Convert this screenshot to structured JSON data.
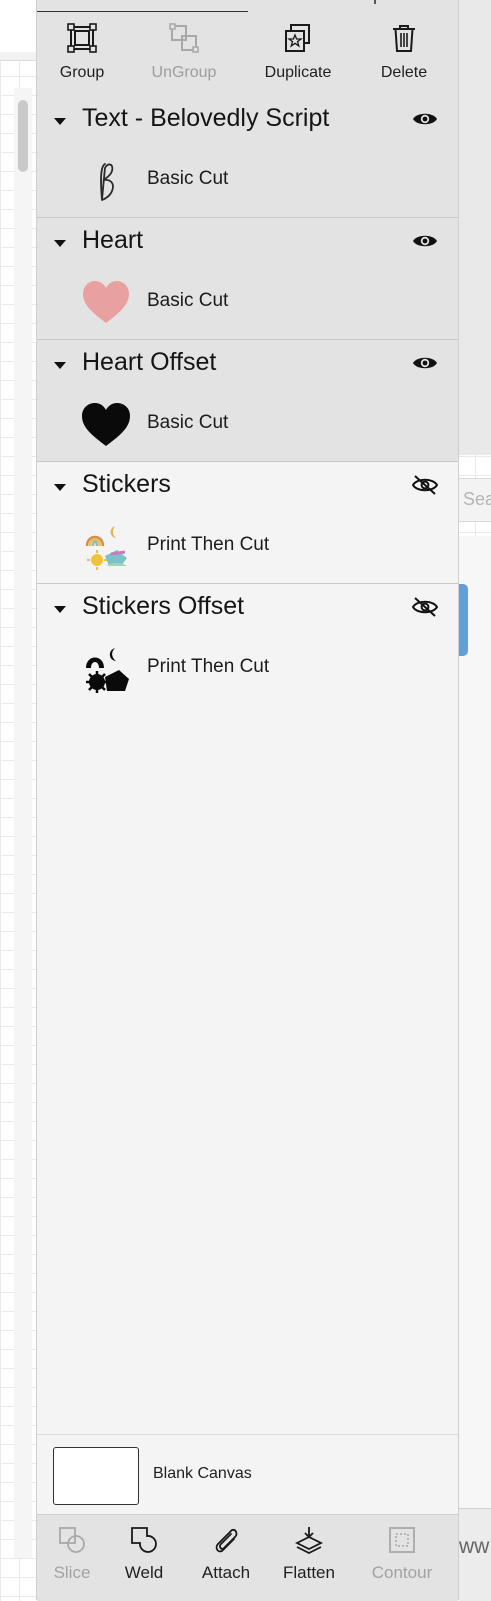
{
  "toolbar": {
    "group": "Group",
    "ungroup": "UnGroup",
    "duplicate": "Duplicate",
    "delete": "Delete"
  },
  "layers": [
    {
      "title": "Text - Belovedly Script",
      "operation": "Basic Cut",
      "visible": true,
      "thumbnail": "script-b-glyph",
      "selected": true
    },
    {
      "title": "Heart",
      "operation": "Basic Cut",
      "visible": true,
      "thumbnail": "pink-heart",
      "selected": true
    },
    {
      "title": "Heart Offset",
      "operation": "Basic Cut",
      "visible": true,
      "thumbnail": "black-heart",
      "selected": true
    },
    {
      "title": "Stickers",
      "operation": "Print Then Cut",
      "visible": false,
      "thumbnail": "color-stickers",
      "selected": false
    },
    {
      "title": "Stickers Offset",
      "operation": "Print Then Cut",
      "visible": false,
      "thumbnail": "black-sticker-silhouettes",
      "selected": false
    }
  ],
  "canvas": {
    "label": "Blank Canvas"
  },
  "bottom_tools": {
    "slice": "Slice",
    "weld": "Weld",
    "attach": "Attach",
    "flatten": "Flatten",
    "contour": "Contour"
  },
  "background": {
    "search_fragment": "Sea",
    "bottom_fragment": "ww"
  },
  "colors": {
    "panel": "#f4f4f4",
    "selected_layer": "#e3e3e3",
    "heart_pink": "#e9a0a0",
    "accent_blue": "#5fa0d8",
    "disabled_text": "#9d9d9d"
  }
}
